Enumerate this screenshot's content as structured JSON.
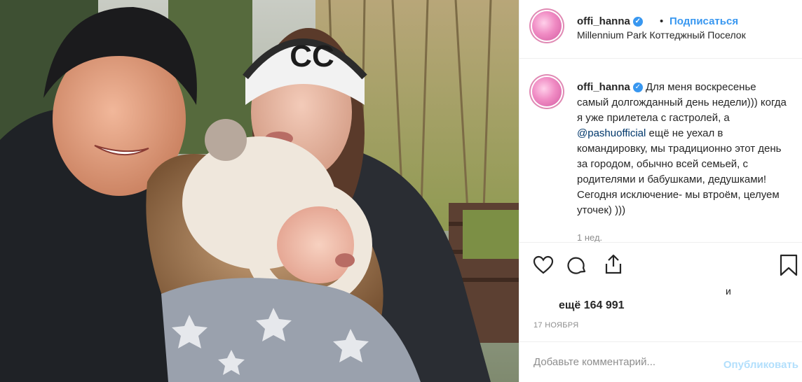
{
  "header": {
    "username": "offi_hanna",
    "separator": "•",
    "follow_label": "Подписаться",
    "location": "Millennium Park Коттеджный Поселок"
  },
  "caption": {
    "username": "offi_hanna",
    "text_1": "Для меня воскресенье самый долгожданный день недели))) когда я уже прилетела с гастролей, а ",
    "mention": "@pashuofficial",
    "text_2": " ещё не уехал в командировку, мы традиционно этот день за городом, обычно всей семьей, с родителями и бабушками, дедушками! Сегодня исключение- мы втроём, целуем уточек) )))",
    "time": "1 нед."
  },
  "likes": {
    "and_text": "и",
    "count_text": "ещё 164 991"
  },
  "date": "17 НОЯБРЯ",
  "comment": {
    "placeholder": "Добавьте комментарий...",
    "publish_label": "Опубликовать"
  },
  "icons": {
    "verified": "verified-badge-icon",
    "like": "heart-icon",
    "comment": "comment-icon",
    "share": "share-icon",
    "save": "bookmark-icon"
  },
  "colors": {
    "accent": "#3897f0",
    "publish_disabled": "#b2dffc",
    "meta_gray": "#8e8e8e",
    "border": "#efefef"
  }
}
